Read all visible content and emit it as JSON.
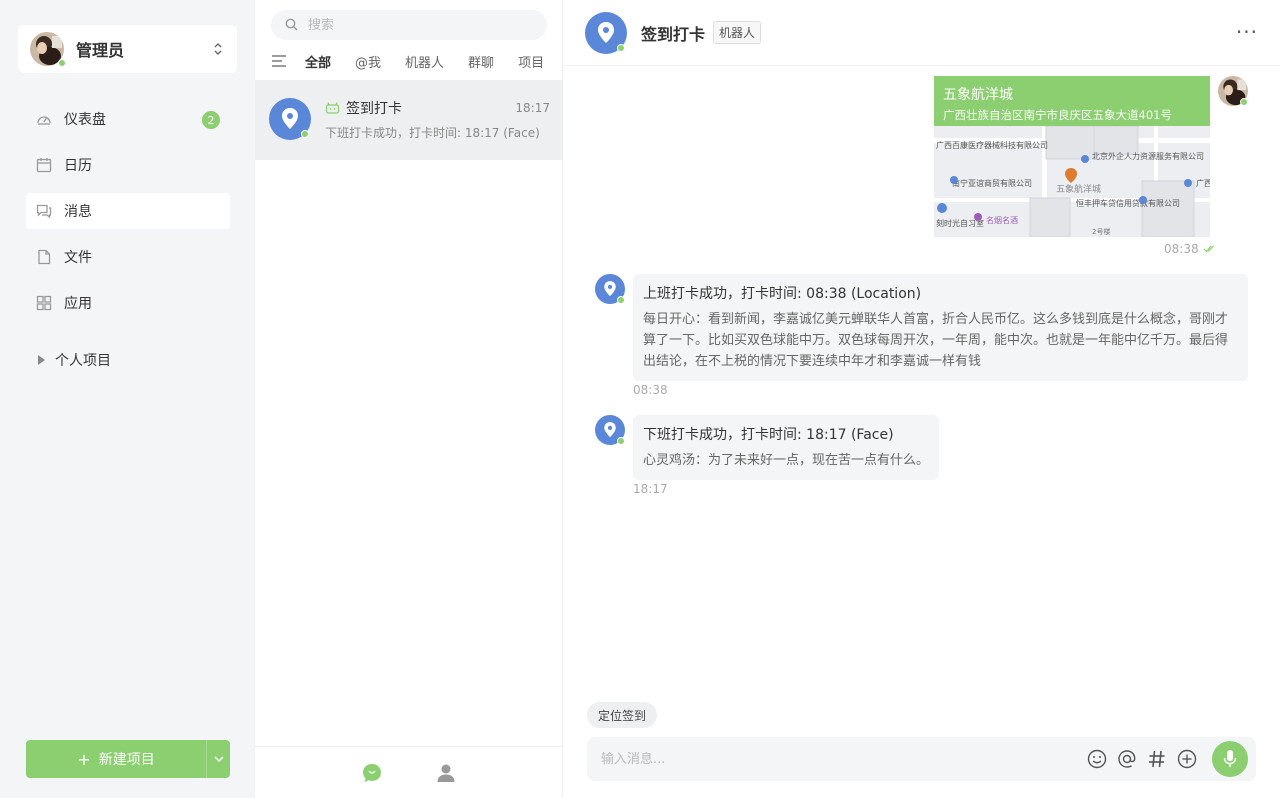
{
  "user": {
    "name": "管理员"
  },
  "nav": [
    {
      "label": "仪表盘",
      "icon": "dashboard-icon",
      "badge": "2"
    },
    {
      "label": "日历",
      "icon": "calendar-icon"
    },
    {
      "label": "消息",
      "icon": "message-icon",
      "active": true
    },
    {
      "label": "文件",
      "icon": "file-icon"
    },
    {
      "label": "应用",
      "icon": "apps-icon"
    }
  ],
  "projects_label": "个人项目",
  "new_project_label": "新建项目",
  "search": {
    "placeholder": "搜索"
  },
  "filters": [
    "全部",
    "@我",
    "机器人",
    "群聊",
    "项目"
  ],
  "conversation": {
    "title": "签到打卡",
    "time": "18:17",
    "preview": "下班打卡成功，打卡时间: 18:17 (Face)"
  },
  "chat": {
    "title": "签到打卡",
    "tag": "机器人",
    "more": "···",
    "location": {
      "name": "五象航洋城",
      "address": "广西壮族自治区南宁市良庆区五象大道401号",
      "time": "08:38",
      "map_labels": [
        "广西百康医疗器械科技有限公司",
        "北京外企人力资源服务有限公司",
        "南宁亚谊商贸有限公司",
        "五象航洋城",
        "恒丰押车贷信用贷款有限公司",
        "名烟名酒",
        "广西律师",
        "2号楼",
        "刻时光自习室"
      ]
    },
    "messages": [
      {
        "title": "上班打卡成功，打卡时间: 08:38 (Location)",
        "text": "每日开心：看到新闻，李嘉诚亿美元蝉联华人首富，折合人民币亿。这么多钱到底是什么概念，哥刚才算了一下。比如买双色球能中万。双色球每周开次，一年周，能中次。也就是一年能中亿千万。最后得出结论，在不上税的情况下要连续中年才和李嘉诚一样有钱",
        "time": "08:38"
      },
      {
        "title": "下班打卡成功，打卡时间: 18:17 (Face)",
        "text": "心灵鸡汤：为了未来好一点，现在苦一点有什么。",
        "time": "18:17"
      }
    ],
    "quick_action": "定位签到",
    "composer_placeholder": "输入消息..."
  },
  "colors": {
    "accent": "#8bcf70",
    "bot_blue": "#5b87d8"
  }
}
